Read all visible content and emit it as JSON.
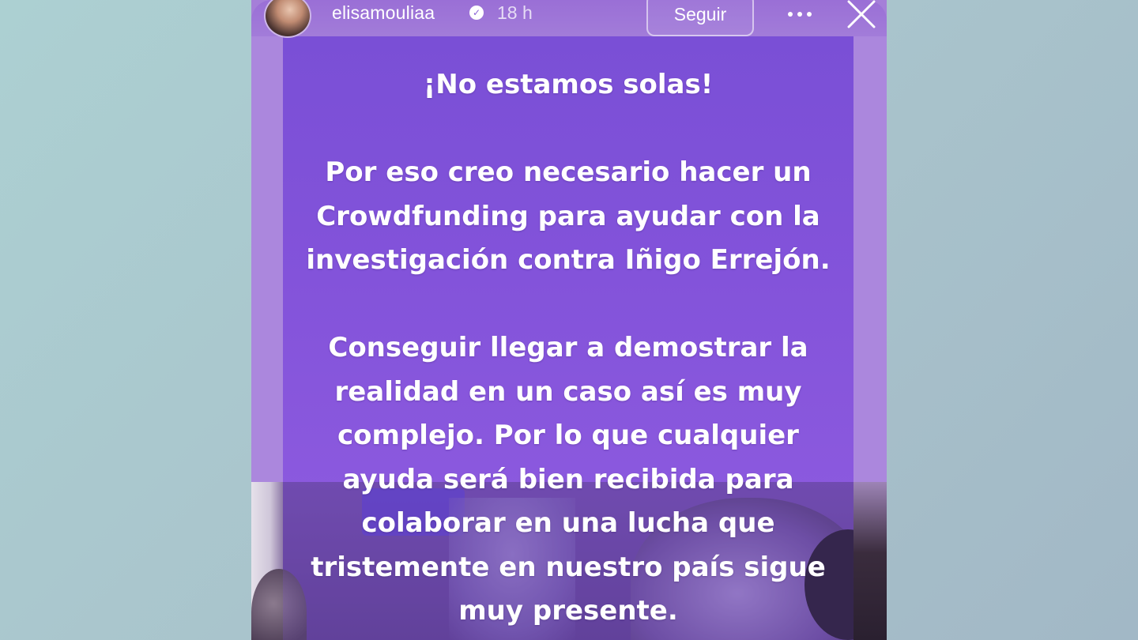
{
  "header": {
    "username": "elisamouliaa",
    "verified_icon": "verified-badge-icon",
    "time": "18 h",
    "follow_label": "Seguir",
    "more_icon": "more-options-icon",
    "close_icon": "close-icon"
  },
  "story": {
    "paragraphs": [
      {
        "lines": [
          "¡No estamos solas!"
        ]
      },
      {
        "lines": [
          "Por eso creo necesario hacer un",
          "Crowdfunding para ayudar con la",
          "investigación contra Iñigo Errejón."
        ]
      },
      {
        "lines": [
          "Conseguir llegar a demostrar la",
          "realidad en un caso así es muy",
          "complejo. Por lo que cualquier",
          "ayuda será bien recibida para",
          "colaborar en una lucha que",
          "tristemente en nuestro país sigue",
          "muy presente."
        ]
      }
    ]
  },
  "colors": {
    "card_purple": "#8353da",
    "frame_lavender": "#ab87dd",
    "background_teal": "#acd0d2",
    "text": "#ffffff"
  }
}
